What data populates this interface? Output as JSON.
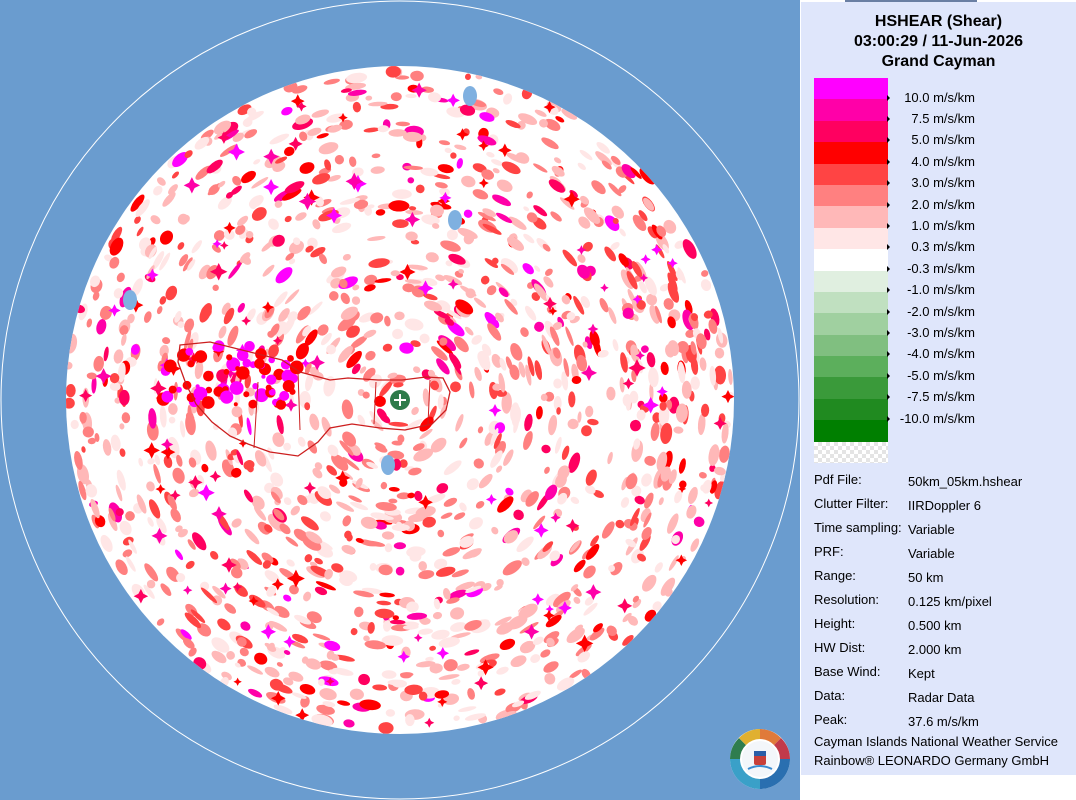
{
  "header": {
    "product": "HSHEAR (Shear)",
    "datetime": "03:00:29 / 11-Jun-2026",
    "site": "Grand Cayman"
  },
  "legend": {
    "items": [
      {
        "label": "10.0 m/s/km",
        "color": "#ff00ff"
      },
      {
        "label": "7.5 m/s/km",
        "color": "#ff00a8"
      },
      {
        "label": "5.0 m/s/km",
        "color": "#ff0060"
      },
      {
        "label": "4.0 m/s/km",
        "color": "#ff0000"
      },
      {
        "label": "3.0 m/s/km",
        "color": "#ff4444"
      },
      {
        "label": "2.0 m/s/km",
        "color": "#ff8080"
      },
      {
        "label": "1.0 m/s/km",
        "color": "#ffb8b8"
      },
      {
        "label": "0.3 m/s/km",
        "color": "#ffe6e6"
      },
      {
        "label": "-0.3 m/s/km",
        "color": "#ffffff"
      },
      {
        "label": "-1.0 m/s/km",
        "color": "#e0efe0"
      },
      {
        "label": "-2.0 m/s/km",
        "color": "#c0e0c0"
      },
      {
        "label": "-3.0 m/s/km",
        "color": "#a0d0a0"
      },
      {
        "label": "-4.0 m/s/km",
        "color": "#80bf80"
      },
      {
        "label": "-5.0 m/s/km",
        "color": "#5caf5c"
      },
      {
        "label": "-7.5 m/s/km",
        "color": "#3a9a3a"
      },
      {
        "label": "-10.0 m/s/km",
        "color": "#208a20"
      }
    ],
    "last_color": "#007f00"
  },
  "info": [
    {
      "key": "Pdf File:",
      "value": "50km_05km.hshear"
    },
    {
      "key": "Clutter Filter:",
      "value": "IIRDoppler 6"
    },
    {
      "key": "Time sampling:",
      "value": "Variable"
    },
    {
      "key": "PRF:",
      "value": "Variable"
    },
    {
      "key": "Range:",
      "value": "50 km"
    },
    {
      "key": "Resolution:",
      "value": "0.125 km/pixel"
    },
    {
      "key": "Height:",
      "value": "0.500 km"
    },
    {
      "key": "HW Dist:",
      "value": "2.000 km"
    },
    {
      "key": "Base Wind:",
      "value": "Kept"
    },
    {
      "key": "Data:",
      "value": "Radar Data"
    },
    {
      "key": "Peak:",
      "value": "37.6 m/s/km"
    }
  ],
  "footer": {
    "line1": "Cayman Islands National Weather Service",
    "line2": "Rainbow® LEONARDO Germany GmbH"
  },
  "map": {
    "background": "#6a9ccf",
    "radar_marker_icon": "radar-site-plus-icon",
    "logo_icon": "cayman-weather-service-logo-icon"
  }
}
